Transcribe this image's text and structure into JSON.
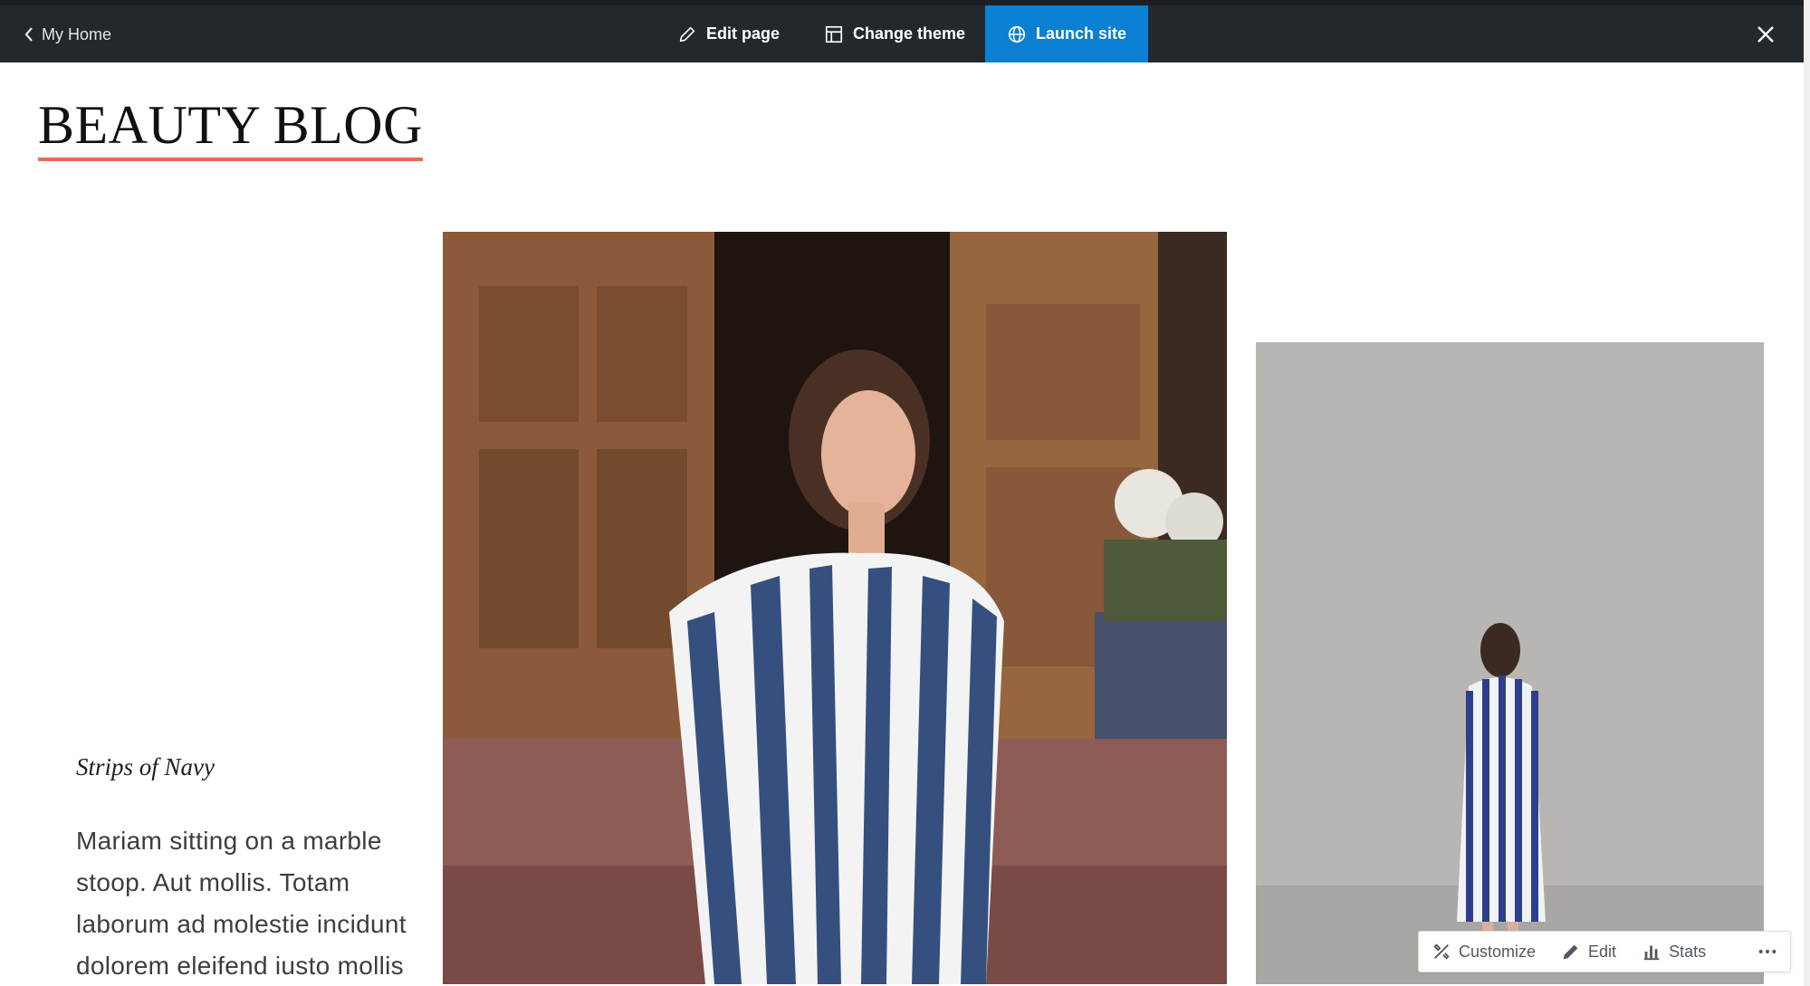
{
  "topbar": {
    "home_label": "My Home",
    "edit_page_label": "Edit page",
    "change_theme_label": "Change theme",
    "launch_site_label": "Launch site"
  },
  "site": {
    "title": "BEAUTY BLOG"
  },
  "post": {
    "title": "Strips of Navy",
    "excerpt": "Mariam sitting on a marble stoop. Aut mollis. Totam laborum ad molestie incidunt dolorem eleifend iusto mollis"
  },
  "floating_toolbar": {
    "customize_label": "Customize",
    "edit_label": "Edit",
    "stats_label": "Stats"
  },
  "colors": {
    "admin_bar": "#23282d",
    "launch_accent": "#0b7fd1",
    "title_underline": "#e76a58"
  },
  "icons": [
    "chevron-left-icon",
    "pencil-icon",
    "layout-icon",
    "globe-icon",
    "close-icon",
    "tools-icon",
    "stats-icon",
    "more-icon"
  ]
}
